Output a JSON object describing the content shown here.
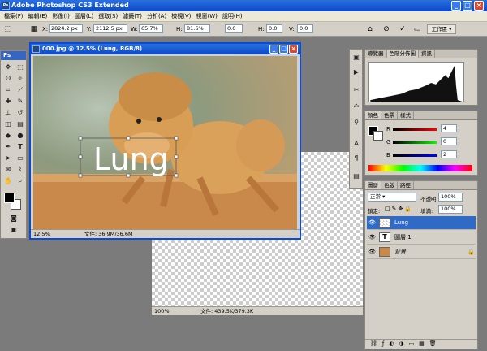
{
  "app": {
    "title": "Adobe Photoshop CS3 Extended",
    "logo": "Ps"
  },
  "menu": [
    "檔案(F)",
    "編輯(E)",
    "影像(I)",
    "圖層(L)",
    "選取(S)",
    "濾鏡(T)",
    "分析(A)",
    "檢視(V)",
    "視窗(W)",
    "說明(H)"
  ],
  "options": {
    "x": "2824.2 px",
    "y": "2112.5 px",
    "w": "65.7%",
    "h": "81.6%",
    "angle": "0.0",
    "hskew": "0.0",
    "vskew": "0.0",
    "workspace": "工作區"
  },
  "document": {
    "title": "000.jpg @ 12.5% (Lung, RGB/8)",
    "zoom": "12.5%",
    "filesize": "文件: 36.9M/36.6M",
    "text_layer": "Lung"
  },
  "document2": {
    "zoom": "100%",
    "filesize": "文件: 439.5K/379.3K"
  },
  "histogram": {
    "tabs": [
      "導覽器",
      "色階分佈圖",
      "資訊"
    ]
  },
  "color": {
    "tabs": [
      "顏色",
      "色票",
      "樣式"
    ],
    "r": "R",
    "g": "G",
    "b": "B",
    "r_val": "4",
    "g_val": "0",
    "b_val": "2"
  },
  "layers": {
    "tabs": [
      "圖層",
      "色版",
      "路徑"
    ],
    "blend": "正常",
    "opacity_label": "不透明:",
    "opacity": "100%",
    "lock_label": "鎖定:",
    "fill_label": "填滿:",
    "fill": "100%",
    "items": [
      {
        "name": "Lung",
        "type": "image"
      },
      {
        "name": "圖層 1",
        "type": "text"
      },
      {
        "name": "背景",
        "type": "photo"
      }
    ]
  },
  "colors": {
    "titlebar": "#0b48c8",
    "selected_layer": "#316ac5"
  }
}
